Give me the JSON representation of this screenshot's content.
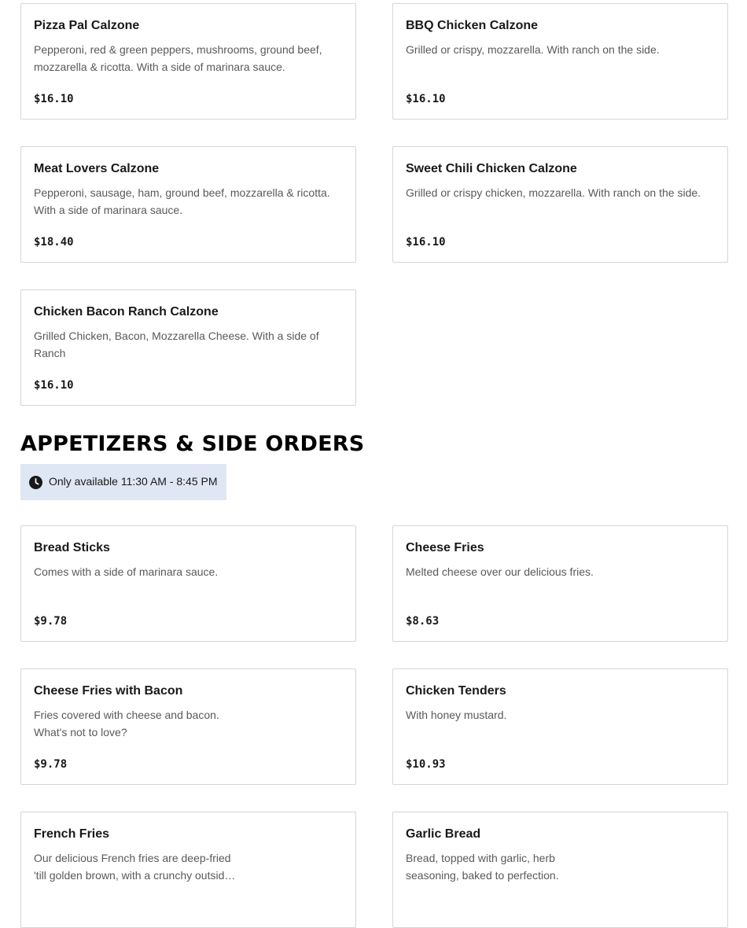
{
  "calzones": {
    "items": [
      {
        "name": "Pizza Pal Calzone",
        "description": "Pepperoni, red & green peppers, mushrooms, ground beef, mozzarella & ricotta. With a side of marinara sauce.",
        "price": "$16.10"
      },
      {
        "name": "BBQ Chicken Calzone",
        "description": "Grilled or crispy, mozzarella. With ranch on the side.",
        "price": "$16.10"
      },
      {
        "name": "Meat Lovers Calzone",
        "description": "Pepperoni, sausage, ham, ground beef, mozzarella & ricotta. With a side of marinara sauce.",
        "price": "$18.40"
      },
      {
        "name": "Sweet Chili Chicken Calzone",
        "description": "Grilled or crispy chicken, mozzarella. With ranch on the side.",
        "price": "$16.10"
      },
      {
        "name": "Chicken Bacon Ranch Calzone",
        "description": "Grilled Chicken, Bacon, Mozzarella Cheese. With a side of Ranch",
        "price": "$16.10"
      }
    ]
  },
  "appetizers": {
    "heading": "APPETIZERS & SIDE ORDERS",
    "availability": "Only available 11:30 AM - 8:45 PM",
    "availability_icon": "clock-icon",
    "badge_color": "#dfe7f5",
    "items": [
      {
        "name": "Bread Sticks",
        "description": "Comes with a side of marinara sauce.",
        "price": "$9.78"
      },
      {
        "name": "Cheese Fries",
        "description": "Melted cheese over our delicious fries.",
        "price": "$8.63"
      },
      {
        "name": "Cheese Fries with Bacon",
        "description": "Fries covered with cheese and bacon. What's not to love?",
        "price": "$9.78"
      },
      {
        "name": "Chicken Tenders",
        "description": "With honey mustard.",
        "price": "$10.93"
      },
      {
        "name": "French Fries",
        "description": "Our delicious French fries are deep-fried 'till golden brown, with a crunchy outside and a fluffy inside.",
        "price": ""
      },
      {
        "name": "Garlic Bread",
        "description": "Bread, topped with garlic, herb seasoning, baked to perfection.",
        "price": ""
      }
    ]
  }
}
